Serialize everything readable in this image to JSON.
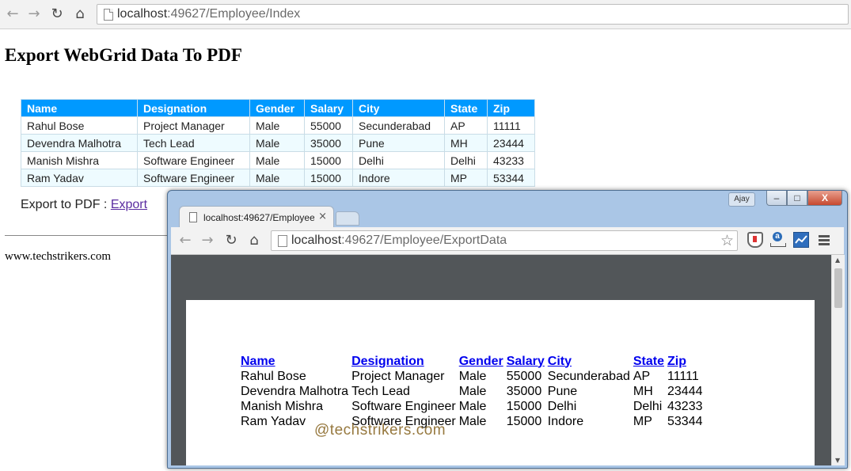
{
  "main_browser": {
    "back_icon": "arrow-left-icon",
    "forward_icon": "arrow-right-icon",
    "reload_icon": "reload-icon",
    "home_icon": "home-icon",
    "url_host": "localhost",
    "url_path": ":49627/Employee/Index"
  },
  "page": {
    "title": "Export WebGrid Data To PDF",
    "columns": [
      "Name",
      "Designation",
      "Gender",
      "Salary",
      "City",
      "State",
      "Zip"
    ],
    "rows": [
      [
        "Rahul Bose",
        "Project Manager",
        "Male",
        "55000",
        "Secunderabad",
        "AP",
        "11111"
      ],
      [
        "Devendra Malhotra",
        "Tech Lead",
        "Male",
        "35000",
        "Pune",
        "MH",
        "23444"
      ],
      [
        "Manish Mishra",
        "Software Engineer",
        "Male",
        "15000",
        "Delhi",
        "Delhi",
        "43233"
      ],
      [
        "Ram Yadav",
        "Software Engineer",
        "Male",
        "15000",
        "Indore",
        "MP",
        "53344"
      ]
    ],
    "export_label": "Export to PDF : ",
    "export_link": "Export",
    "footer": "www.techstrikers.com"
  },
  "popup": {
    "user_tag": "Ajay",
    "min_label": "–",
    "max_label": "□",
    "close_label": "X",
    "tab_title": "localhost:49627/Employee",
    "tab_close": "×",
    "url_host": "localhost",
    "url_path": ":49627/Employee/ExportData",
    "pdf_columns": [
      "Name",
      "Designation",
      "Gender",
      "Salary",
      "City",
      "State",
      "Zip"
    ],
    "pdf_rows": [
      [
        "Rahul Bose",
        "Project Manager",
        "Male",
        "55000",
        "Secunderabad",
        "AP",
        "11111"
      ],
      [
        "Devendra Malhotra",
        "Tech Lead",
        "Male",
        "35000",
        "Pune",
        "MH",
        "23444"
      ],
      [
        "Manish Mishra",
        "Software Engineer",
        "Male",
        "15000",
        "Delhi",
        "Delhi",
        "43233"
      ],
      [
        "Ram Yadav",
        "Software Engineer",
        "Male",
        "15000",
        "Indore",
        "MP",
        "53344"
      ]
    ],
    "watermark": "@techstrikers.com"
  },
  "colors": {
    "grid_header": "#0099ff",
    "grid_alt_row": "#eefbff",
    "link_visited": "#5a2ca0",
    "pdf_viewer_bg": "#525659"
  }
}
